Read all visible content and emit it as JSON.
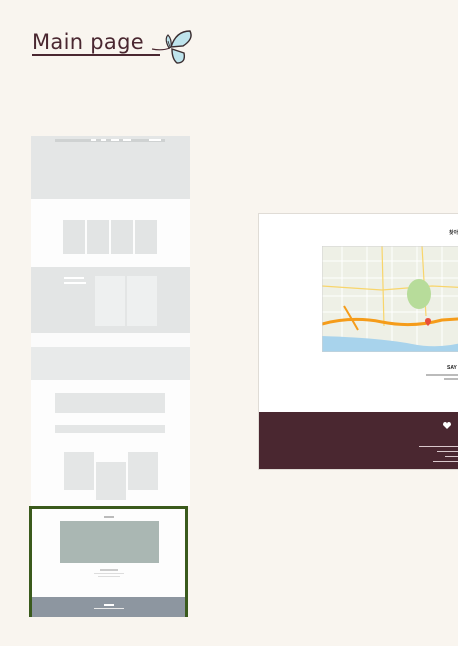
{
  "page": {
    "title": "Main page"
  },
  "colors": {
    "background": "#f9f5ef",
    "title": "#4a2730",
    "highlight_border": "#3a5a1c",
    "footer": "#4a2730",
    "thumb_gray": "#e4e6e6",
    "map_box": "#aab7b3",
    "thumb_footer": "#8d96a0"
  },
  "icons": [
    "butterfly-icon",
    "map-pin-icon"
  ],
  "thumbnail": {
    "sections": [
      "header",
      "products",
      "banner",
      "divider",
      "content",
      "contact-map"
    ]
  },
  "detail": {
    "header_text": "찾아",
    "brand_text": "SAY",
    "footer_icon": "heart-icon"
  }
}
